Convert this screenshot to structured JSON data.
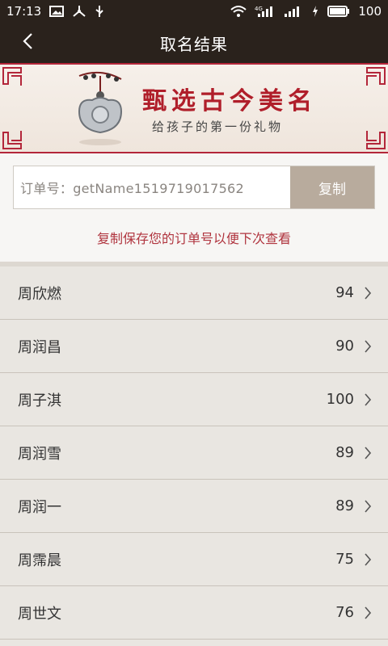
{
  "status_bar": {
    "time": "17:13",
    "battery": "100",
    "network": "4G"
  },
  "nav": {
    "title": "取名结果"
  },
  "banner": {
    "title": "甄选古今美名",
    "subtitle": "给孩子的第一份礼物"
  },
  "order": {
    "label": "订单号：getName1519719017562",
    "copy_label": "复制",
    "hint": "复制保存您的订单号以便下次查看"
  },
  "names": [
    {
      "name": "周欣燃",
      "score": "94"
    },
    {
      "name": "周润昌",
      "score": "90"
    },
    {
      "name": "周子淇",
      "score": "100"
    },
    {
      "name": "周润雪",
      "score": "89"
    },
    {
      "name": "周润一",
      "score": "89"
    },
    {
      "name": "周霈晨",
      "score": "75"
    },
    {
      "name": "周世文",
      "score": "76"
    }
  ],
  "colors": {
    "header_bg": "#2a221c",
    "accent_red": "#b01e2a",
    "copy_button": "#b8ab9d"
  }
}
